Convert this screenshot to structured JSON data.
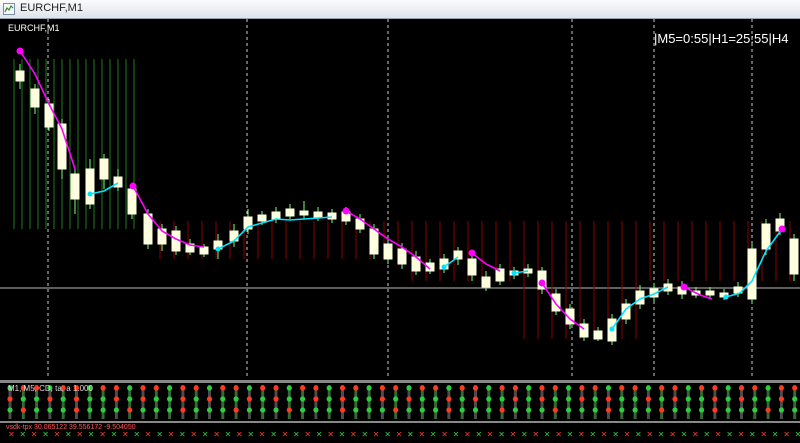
{
  "window": {
    "title": "EURCHF,M1"
  },
  "chart": {
    "symbol_label": "EURCHF,M1",
    "timer_text": "|M5=0:55|H1=25:55|H4",
    "subwindow_label": "M1, M5, CD, ta, a 1.000",
    "subwindow2_label": "vsdk-tpx 30.065122 39.556172 -9.504050",
    "colors": {
      "background": "#000000",
      "bull_candle": "#ffffe0",
      "bear_candle": "#ffffe0",
      "wick": "#7cff7c",
      "ma_down": "#ff00ff",
      "ma_up": "#00e5ff",
      "hist_green": "#1d7a1d",
      "hist_red": "#8a0000",
      "grid": "#ffffff",
      "indicator_red": "#ff3b1f",
      "indicator_green": "#2ecc40"
    },
    "indicator_rows": [
      "row1",
      "row2",
      "row3"
    ]
  }
}
